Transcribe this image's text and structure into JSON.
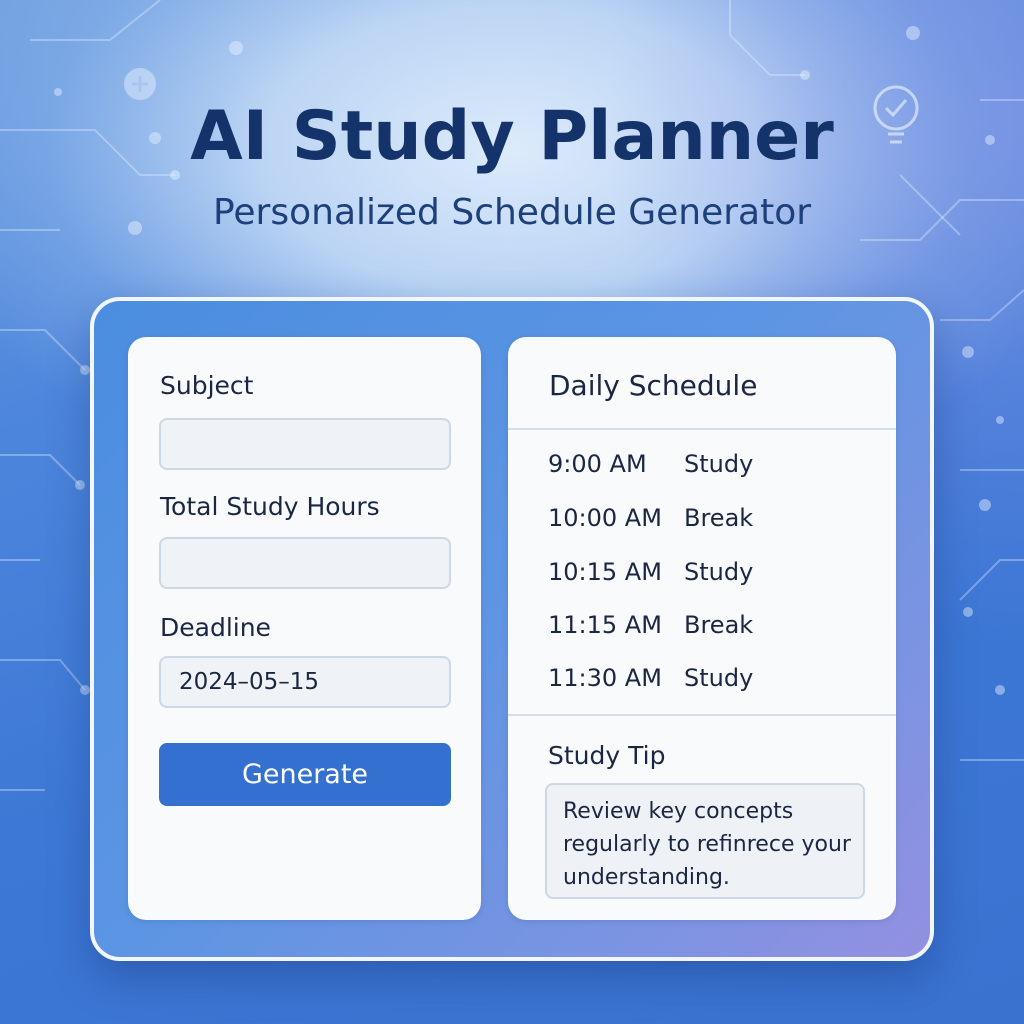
{
  "header": {
    "title": "AI Study Planner",
    "subtitle": "Personalized Schedule Generator"
  },
  "form": {
    "subject_label": "Subject",
    "subject_value": "",
    "hours_label": "Total Study Hours",
    "hours_value": "",
    "deadline_label": "Deadline",
    "deadline_value": "2024–05–15",
    "generate_label": "Generate"
  },
  "schedule": {
    "title": "Daily Schedule",
    "rows": [
      {
        "time": "9:00 AM",
        "activity": "Study"
      },
      {
        "time": "10:00 AM",
        "activity": "Break"
      },
      {
        "time": "10:15 AM",
        "activity": "Study"
      },
      {
        "time": "11:15 AM",
        "activity": "Break"
      },
      {
        "time": "11:30 AM",
        "activity": "Study"
      }
    ]
  },
  "tip": {
    "title": "Study Tip",
    "text": "Review key concepts regularly to refinrece your understanding."
  },
  "decor": {
    "icons": [
      "plus-circle-icon",
      "lightbulb-icon"
    ]
  },
  "colors": {
    "accent": "#3370cf",
    "title": "#15336b"
  }
}
